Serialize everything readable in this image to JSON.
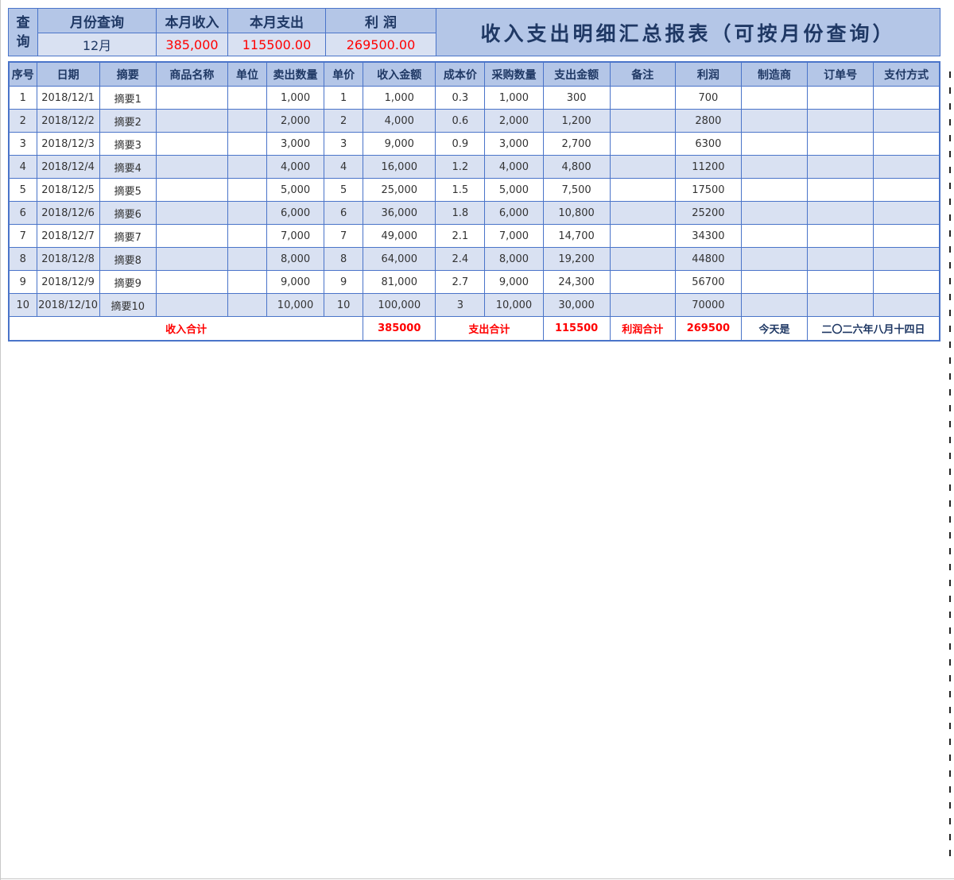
{
  "query_panel": {
    "side_label_1": "查",
    "side_label_2": "询",
    "month_header": "月份查询",
    "month_value": "12月",
    "income_header": "本月收入",
    "income_value": "385,000",
    "expense_header": "本月支出",
    "expense_value": "115500.00",
    "profit_header": "利 润",
    "profit_value": "269500.00"
  },
  "title": "收入支出明细汇总报表（可按月份查询）",
  "table": {
    "headers": [
      "序号",
      "日期",
      "摘要",
      "商品名称",
      "单位",
      "卖出数量",
      "单价",
      "收入金额",
      "成本价",
      "采购数量",
      "支出金额",
      "备注",
      "利润",
      "制造商",
      "订单号",
      "支付方式"
    ],
    "rows": [
      [
        "1",
        "2018/12/1",
        "摘要1",
        "",
        "",
        "1,000",
        "1",
        "1,000",
        "0.3",
        "1,000",
        "300",
        "",
        "700",
        "",
        "",
        ""
      ],
      [
        "2",
        "2018/12/2",
        "摘要2",
        "",
        "",
        "2,000",
        "2",
        "4,000",
        "0.6",
        "2,000",
        "1,200",
        "",
        "2800",
        "",
        "",
        ""
      ],
      [
        "3",
        "2018/12/3",
        "摘要3",
        "",
        "",
        "3,000",
        "3",
        "9,000",
        "0.9",
        "3,000",
        "2,700",
        "",
        "6300",
        "",
        "",
        ""
      ],
      [
        "4",
        "2018/12/4",
        "摘要4",
        "",
        "",
        "4,000",
        "4",
        "16,000",
        "1.2",
        "4,000",
        "4,800",
        "",
        "11200",
        "",
        "",
        ""
      ],
      [
        "5",
        "2018/12/5",
        "摘要5",
        "",
        "",
        "5,000",
        "5",
        "25,000",
        "1.5",
        "5,000",
        "7,500",
        "",
        "17500",
        "",
        "",
        ""
      ],
      [
        "6",
        "2018/12/6",
        "摘要6",
        "",
        "",
        "6,000",
        "6",
        "36,000",
        "1.8",
        "6,000",
        "10,800",
        "",
        "25200",
        "",
        "",
        ""
      ],
      [
        "7",
        "2018/12/7",
        "摘要7",
        "",
        "",
        "7,000",
        "7",
        "49,000",
        "2.1",
        "7,000",
        "14,700",
        "",
        "34300",
        "",
        "",
        ""
      ],
      [
        "8",
        "2018/12/8",
        "摘要8",
        "",
        "",
        "8,000",
        "8",
        "64,000",
        "2.4",
        "8,000",
        "19,200",
        "",
        "44800",
        "",
        "",
        ""
      ],
      [
        "9",
        "2018/12/9",
        "摘要9",
        "",
        "",
        "9,000",
        "9",
        "81,000",
        "2.7",
        "9,000",
        "24,300",
        "",
        "56700",
        "",
        "",
        ""
      ],
      [
        "10",
        "2018/12/10",
        "摘要10",
        "",
        "",
        "10,000",
        "10",
        "100,000",
        "3",
        "10,000",
        "30,000",
        "",
        "70000",
        "",
        "",
        ""
      ]
    ],
    "totals": {
      "income_label": "收入合计",
      "income_value": "385000",
      "expense_label": "支出合计",
      "expense_value": "115500",
      "profit_label": "利润合计",
      "profit_value": "269500",
      "today_label": "今天是",
      "today_value": "二〇二六年八月十四日"
    }
  },
  "colors": {
    "header_bg": "#b4c6e7",
    "stripe_bg": "#d9e1f2",
    "border": "#4a74c9",
    "title_text": "#1f3864",
    "highlight_text": "#ff0000"
  }
}
